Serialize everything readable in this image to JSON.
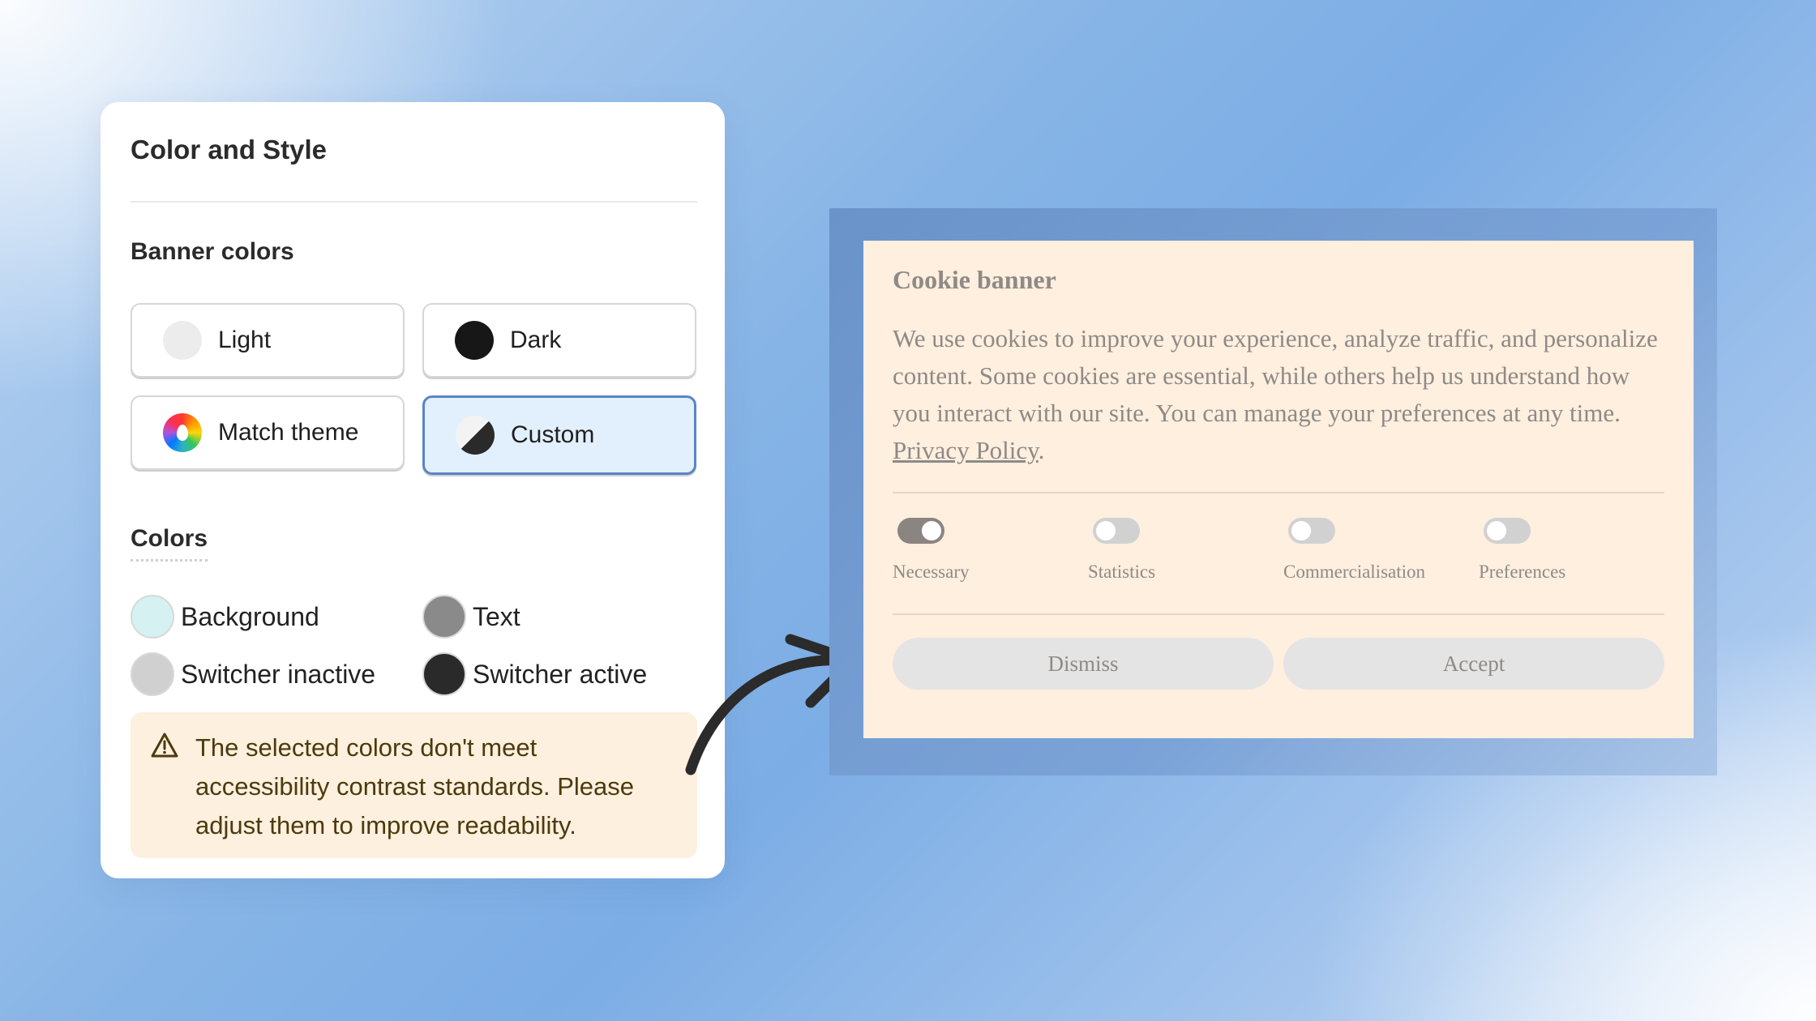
{
  "panel": {
    "title": "Color and Style",
    "banner_colors_title": "Banner colors",
    "options": [
      {
        "label": "Light",
        "icon": "light-swatch-icon",
        "selected": false
      },
      {
        "label": "Dark",
        "icon": "dark-swatch-icon",
        "selected": false
      },
      {
        "label": "Match theme",
        "icon": "rainbow-swatch-icon",
        "selected": false
      },
      {
        "label": "Custom",
        "icon": "custom-swatch-icon",
        "selected": true
      }
    ],
    "colors_title": "Colors",
    "swatches": [
      {
        "label": "Background",
        "color": "#d6f1f1"
      },
      {
        "label": "Text",
        "color": "#8a8a8a"
      },
      {
        "label": "Switcher inactive",
        "color": "#d0d0d0"
      },
      {
        "label": "Switcher active",
        "color": "#2a2a2a"
      }
    ],
    "warning": {
      "icon": "warning-triangle-icon",
      "text": "The selected colors don't meet accessibility contrast standards. Please adjust them to improve readability."
    }
  },
  "banner": {
    "title": "Cookie banner",
    "body": "We use cookies to improve your experience, analyze traffic, and personalize content. Some cookies are essential, while others help us understand how you interact with our site. You can manage your preferences at any time.",
    "link": "Privacy Policy",
    "link_suffix": ".",
    "toggles": [
      {
        "label": "Necessary",
        "on": true
      },
      {
        "label": "Statistics",
        "on": false
      },
      {
        "label": "Commercialisation",
        "on": false
      },
      {
        "label": "Preferences",
        "on": false
      }
    ],
    "buttons": {
      "dismiss": "Dismiss",
      "accept": "Accept"
    },
    "background_color": "#ffefdf"
  }
}
